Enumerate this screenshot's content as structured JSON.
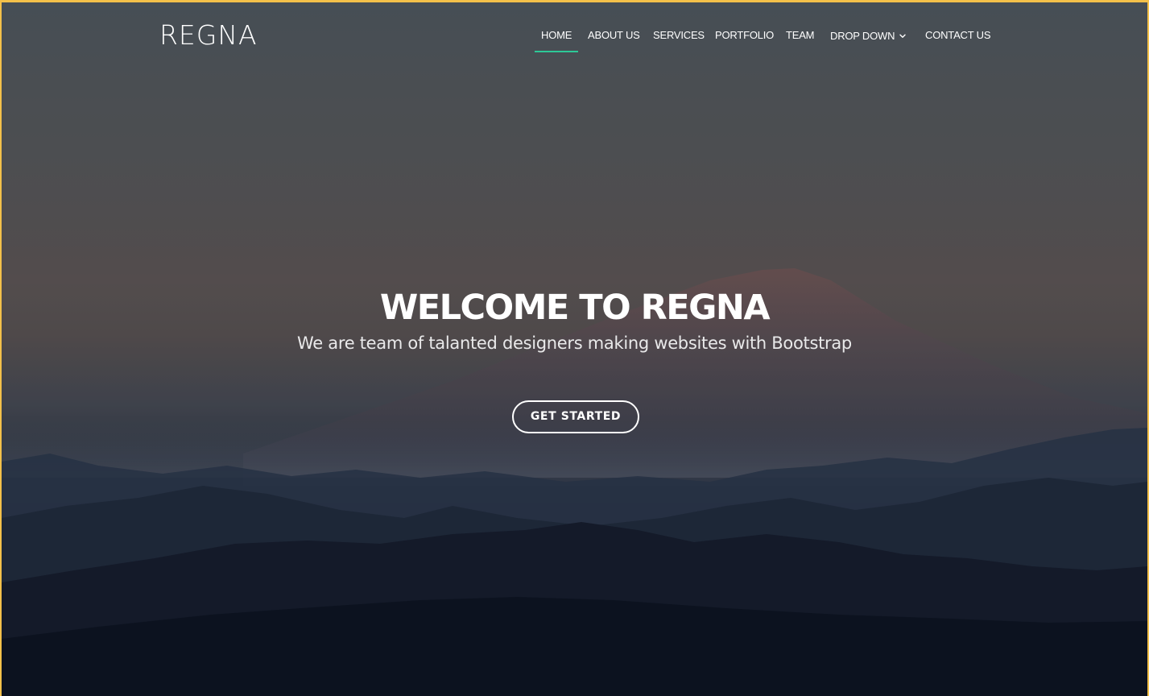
{
  "brand": {
    "logo_text": "REGNA"
  },
  "nav": {
    "items": [
      {
        "label": "HOME",
        "active": true
      },
      {
        "label": "ABOUT US",
        "active": false
      },
      {
        "label": "SERVICES",
        "active": false
      },
      {
        "label": "PORTFOLIO",
        "active": false
      },
      {
        "label": "TEAM",
        "active": false
      },
      {
        "label": "DROP DOWN",
        "active": false,
        "icon": "chevron-down-icon"
      },
      {
        "label": "CONTACT US",
        "active": false
      }
    ]
  },
  "hero": {
    "title": "WELCOME TO REGNA",
    "subtitle": "We are team of talanted designers making websites with Bootstrap",
    "cta_label": "GET STARTED"
  },
  "colors": {
    "accent": "#2dc997",
    "frame_border": "#f3c04a",
    "text": "#ffffff"
  }
}
